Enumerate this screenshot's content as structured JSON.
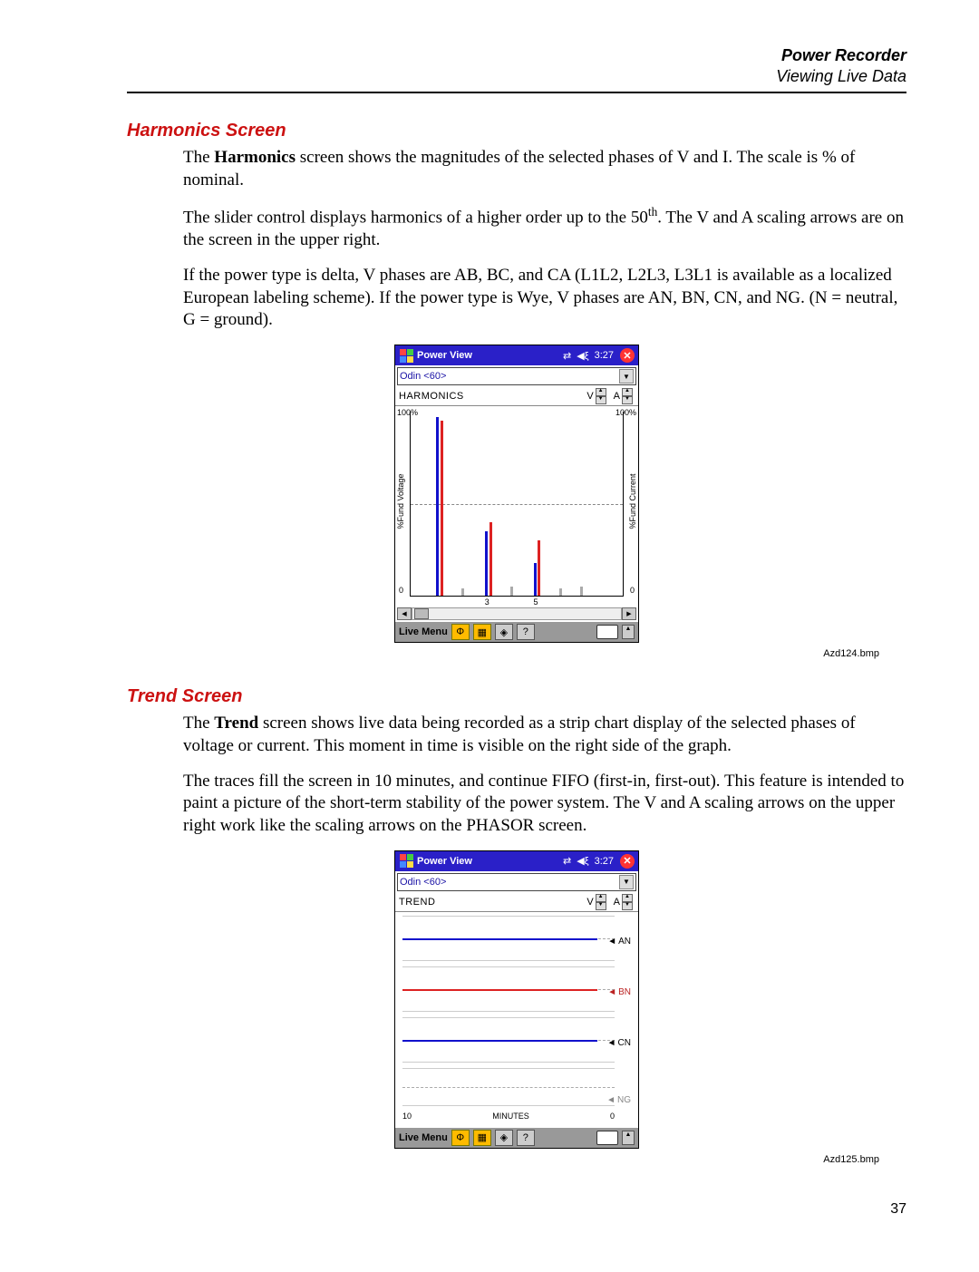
{
  "header": {
    "line1": "Power Recorder",
    "line2": "Viewing Live Data"
  },
  "page_number": "37",
  "sections": {
    "harmonics": {
      "heading": "Harmonics Screen",
      "p1_a": "The ",
      "p1_b": "Harmonics",
      "p1_c": " screen shows the magnitudes of the selected phases of V and I. The scale is % of nominal.",
      "p2_a": "The slider control displays harmonics of a higher order up to the 50",
      "p2_sup": "th",
      "p2_b": ". The V and A scaling arrows are on the screen in the upper right.",
      "p3": "If the power type is delta, V phases are AB, BC, and CA (L1L2, L2L3, L3L1 is available as a localized European labeling scheme). If the power type is Wye, V phases are AN, BN, CN, and NG. (N = neutral, G = ground)."
    },
    "trend": {
      "heading": "Trend Screen",
      "p1_a": "The ",
      "p1_b": "Trend",
      "p1_c": " screen shows live data being recorded as a strip chart display of the selected phases of voltage or current. This moment in time is visible on the right side of the graph.",
      "p2": "The traces fill the screen in 10 minutes, and continue FIFO (first-in, first-out). This feature is intended to paint a picture of the short-term stability of the power system. The V and A scaling arrows on the upper right work like the scaling arrows on the PHASOR screen."
    }
  },
  "captions": {
    "c1": "Azd124.bmp",
    "c2": "Azd125.bmp"
  },
  "screenshot_common": {
    "title": "Power View",
    "time": "3:27",
    "dropdown": "Odin <60>",
    "menubar": "Live Menu",
    "v_label": "V",
    "a_label": "A"
  },
  "harmonics_shot": {
    "subbar": "HARMONICS",
    "y_left_label": "%Fund Voltage",
    "y_right_label": "%Fund Current",
    "y_top": "100%",
    "y_bot": "0",
    "xticks": [
      "3",
      "5"
    ]
  },
  "trend_shot": {
    "subbar": "TREND",
    "rows": [
      "AN",
      "BN",
      "CN",
      "NG"
    ],
    "x_left": "10",
    "x_center": "MINUTES",
    "x_right": "0"
  },
  "chart_data": [
    {
      "type": "bar",
      "title": "HARMONICS",
      "ylabel_left": "%Fund Voltage",
      "ylabel_right": "%Fund Current",
      "ylim": [
        0,
        100
      ],
      "x_harmonic_order": [
        1,
        2,
        3,
        4,
        5,
        6,
        7
      ],
      "series": [
        {
          "name": "V phase A (blue)",
          "values": [
            100,
            2,
            35,
            4,
            18,
            2,
            3
          ]
        },
        {
          "name": "V phase B (red)",
          "values": [
            98,
            2,
            40,
            3,
            30,
            2,
            3
          ]
        },
        {
          "name": "threshold dashed",
          "values": [
            50,
            50,
            50,
            50,
            50,
            50,
            50
          ]
        }
      ],
      "notes": "Slider at left end; harmonics shown roughly 1–7 of 50"
    },
    {
      "type": "line",
      "title": "TREND",
      "xlabel": "MINUTES",
      "xlim": [
        10,
        0
      ],
      "channels": [
        {
          "name": "AN",
          "color": "blue",
          "value": "flat nominal"
        },
        {
          "name": "BN",
          "color": "red",
          "value": "flat nominal"
        },
        {
          "name": "CN",
          "color": "blue",
          "value": "flat nominal"
        },
        {
          "name": "NG",
          "color": "gray",
          "value": "flat near zero"
        }
      ]
    }
  ]
}
